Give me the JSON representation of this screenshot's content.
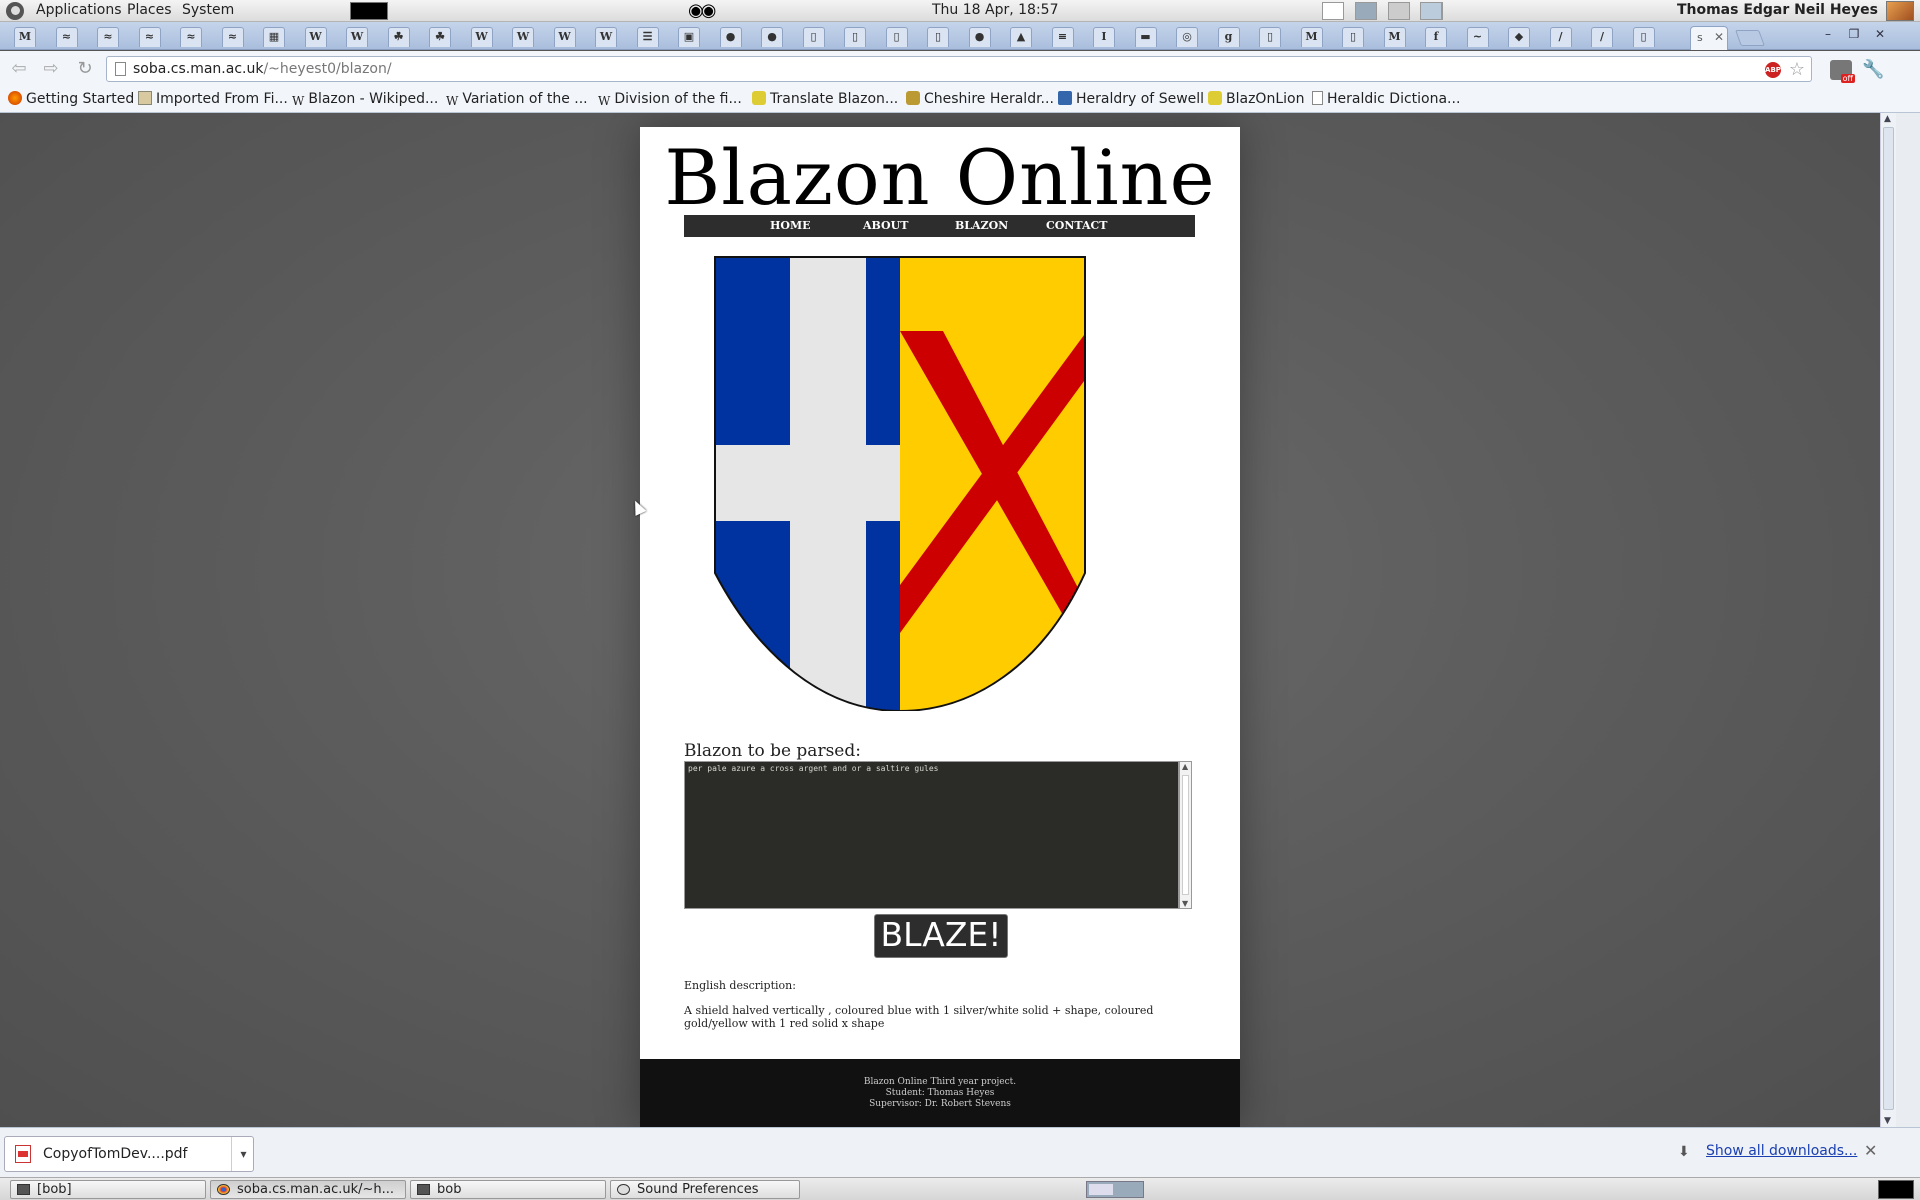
{
  "system_panel": {
    "menus": [
      "Applications",
      "Places",
      "System"
    ],
    "clock": "Thu 18 Apr, 18:57",
    "user": "Thomas Edgar Neil Heyes"
  },
  "browser": {
    "active_tab_label": "s",
    "pinned_tabs": [
      "M",
      "≈",
      "≈",
      "≈",
      "≈",
      "≈",
      "▦",
      "W",
      "W",
      "☘",
      "☘",
      "W",
      "W",
      "W",
      "W",
      "☰",
      "▣",
      "●",
      "●",
      "▯",
      "▯",
      "▯",
      "▯",
      "●",
      "▲",
      "≡",
      "I",
      "▬",
      "◎",
      "g",
      "▯",
      "M",
      "▯",
      "M",
      "f",
      "~",
      "◆",
      "/",
      "/",
      "▯"
    ],
    "url_host": "soba.cs.man.ac.uk",
    "url_path": "/~heyest0/blazon/",
    "bookmarks": [
      "Getting Started",
      "Imported From Fi...",
      "Blazon - Wikiped...",
      "Variation of the ...",
      "Division of the fi...",
      "Translate Blazon...",
      "Cheshire Heraldr...",
      "Heraldry of Sewell",
      "BlazOnLion",
      "Heraldic Dictiona..."
    ]
  },
  "page": {
    "title": "Blazon Online",
    "nav": [
      "HOME",
      "ABOUT",
      "BLAZON",
      "CONTACT"
    ],
    "shield": {
      "division": "per pale",
      "dexter_field": "#0033a0",
      "dexter_charge": "cross",
      "dexter_charge_color": "#e6e6e6",
      "sinister_field": "#ffcc00",
      "sinister_charge": "saltire",
      "sinister_charge_color": "#cc0000"
    },
    "blazon_label": "Blazon to be parsed:",
    "blazon_value": "per pale azure a cross argent and or a saltire gules",
    "blaze_button": "BLAZE!",
    "english_label": "English description:",
    "english_text": "A shield halved vertically , coloured blue with 1 silver/white solid + shape, coloured gold/yellow with 1 red solid x shape",
    "footer": [
      "Blazon Online Third year project.",
      "Student: Thomas Heyes",
      "Supervisor: Dr. Robert Stevens"
    ]
  },
  "downloads": {
    "file": "CopyofTomDev....pdf",
    "show_all": "Show all downloads..."
  },
  "taskbar": {
    "tasks": [
      "[bob]",
      "soba.cs.man.ac.uk/~h...",
      "bob",
      "Sound Preferences"
    ]
  }
}
